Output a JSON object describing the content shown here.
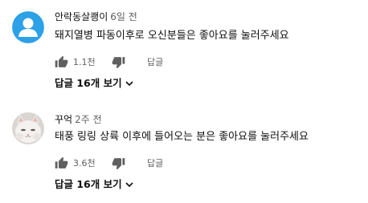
{
  "comments": [
    {
      "author": "안락동살쾡이",
      "time": "6일 전",
      "text": "돼지열병 파동이후로 오신분들은 좋아요를 눌러주세요",
      "likes": "1.1천",
      "reply_label": "답글",
      "view_replies": "답글 16개 보기",
      "avatar": "default-person-avatar"
    },
    {
      "author": "꾸억",
      "time": "2주 전",
      "text": "태풍 링링 상륙 이후에 들어오는 분은 좋아요를 눌러주세요",
      "likes": "3.6천",
      "reply_label": "답글",
      "view_replies": "답글 16개 보기",
      "avatar": "cat-photo-avatar"
    }
  ],
  "colors": {
    "text_primary": "#0f0f0f",
    "text_secondary": "#606060",
    "avatar_blue": "#2da1e8"
  }
}
